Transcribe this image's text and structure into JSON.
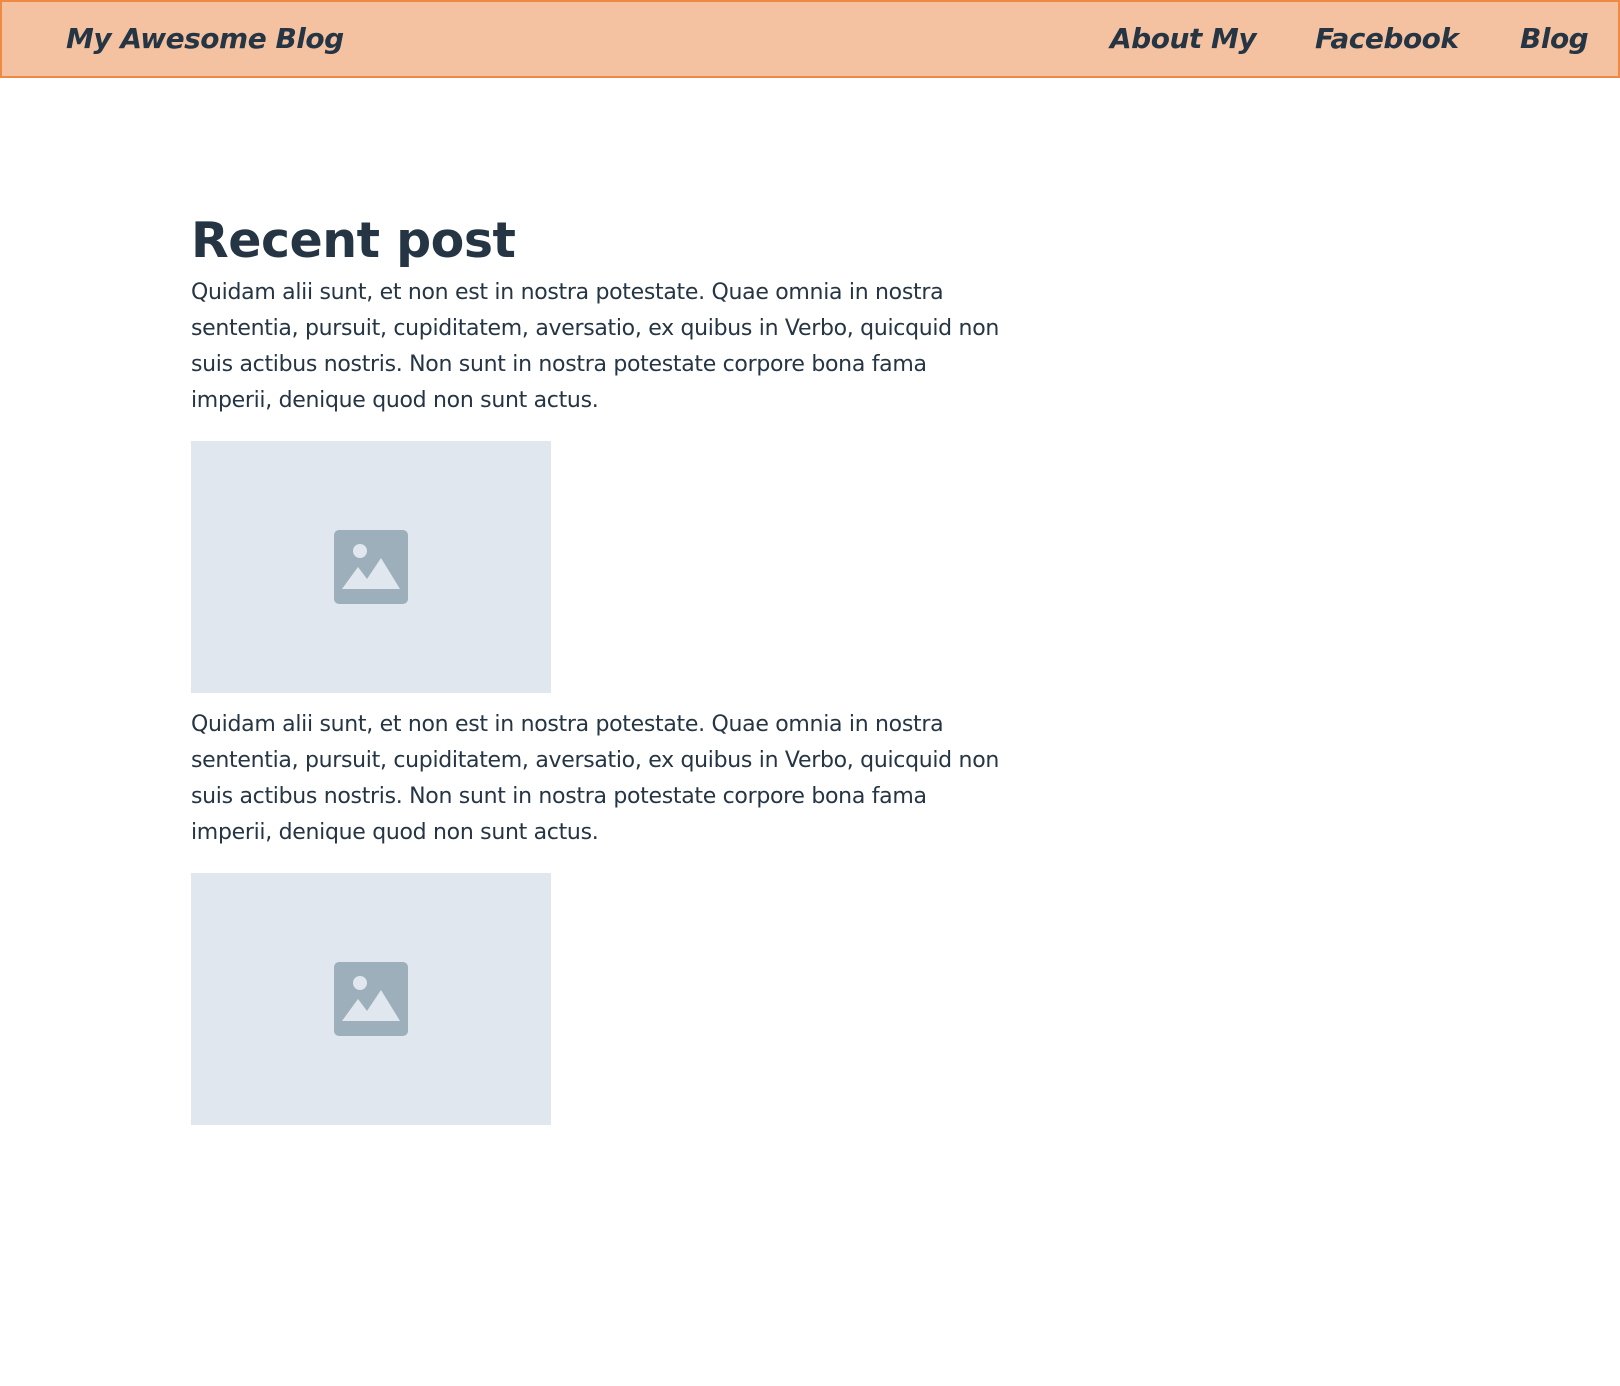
{
  "navbar": {
    "brand": "My Awesome Blog",
    "links": [
      {
        "label": "About My"
      },
      {
        "label": "Facebook"
      },
      {
        "label": "Blog"
      }
    ],
    "background_color": "#f4c2a0",
    "border_color": "#ef8a45"
  },
  "main": {
    "title": "Recent post",
    "posts": [
      {
        "text": "Quidam alii sunt, et non est in nostra potestate. Quae omnia in nostra sententia, pursuit, cupiditatem, aversatio, ex quibus in Verbo, quicquid non suis actibus nostris. Non sunt in nostra potestate corpore bona fama imperii, denique quod non sunt actus.",
        "image_icon": "image-placeholder-icon"
      },
      {
        "text": "Quidam alii sunt, et non est in nostra potestate. Quae omnia in nostra sententia, pursuit, cupiditatem, aversatio, ex quibus in Verbo, quicquid non suis actibus nostris. Non sunt in nostra potestate corpore bona fama imperii, denique quod non sunt actus.",
        "image_icon": "image-placeholder-icon"
      }
    ]
  },
  "colors": {
    "text": "#263544",
    "placeholder_bg": "#e1e7ef",
    "placeholder_icon": "#9eafbc"
  }
}
